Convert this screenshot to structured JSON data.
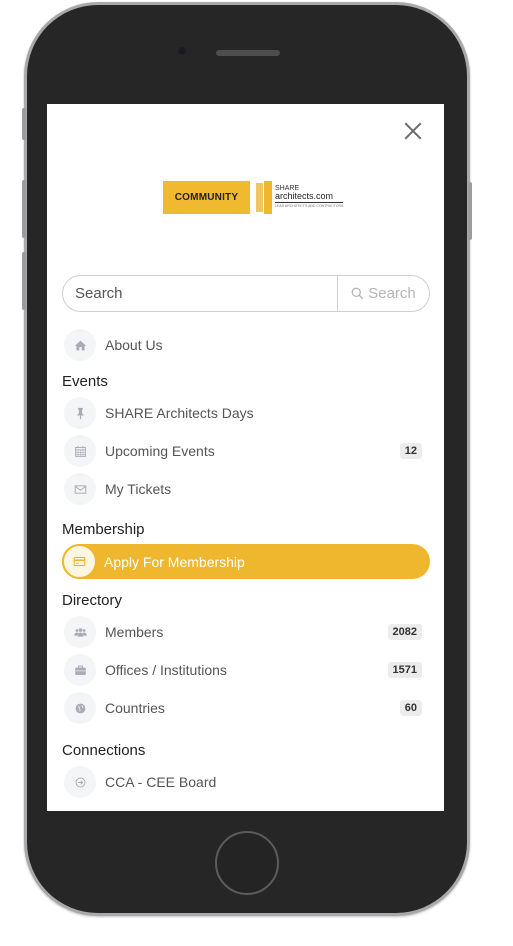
{
  "logo": {
    "community": "COMMUNITY",
    "brand_line1": "SHARE",
    "brand_line2": "architects.com",
    "brand_line3": "LEAD ARCHITECTS AND CONTRACTORS"
  },
  "search": {
    "placeholder": "Search",
    "button_label": "Search"
  },
  "menu": {
    "about": {
      "label": "About Us",
      "icon": "home-icon"
    },
    "events": {
      "title": "Events",
      "items": [
        {
          "label": "SHARE Architects Days",
          "icon": "pin-icon"
        },
        {
          "label": "Upcoming Events",
          "icon": "calendar-icon",
          "badge": "12"
        },
        {
          "label": "My Tickets",
          "icon": "envelope-icon"
        }
      ]
    },
    "membership": {
      "title": "Membership",
      "items": [
        {
          "label": "Apply For Membership",
          "icon": "credit-card-icon",
          "active": true
        }
      ]
    },
    "directory": {
      "title": "Directory",
      "items": [
        {
          "label": "Members",
          "icon": "users-icon",
          "badge": "2082"
        },
        {
          "label": "Offices / Institutions",
          "icon": "briefcase-icon",
          "badge": "1571"
        },
        {
          "label": "Countries",
          "icon": "globe-icon",
          "badge": "60"
        }
      ]
    },
    "connections": {
      "title": "Connections",
      "items": [
        {
          "label": "CCA - CEE Board",
          "icon": "arrow-circle-icon"
        }
      ]
    }
  },
  "colors": {
    "accent": "#efb72e",
    "icon_gray": "#a6adb6",
    "badge_bg": "#ececec"
  }
}
